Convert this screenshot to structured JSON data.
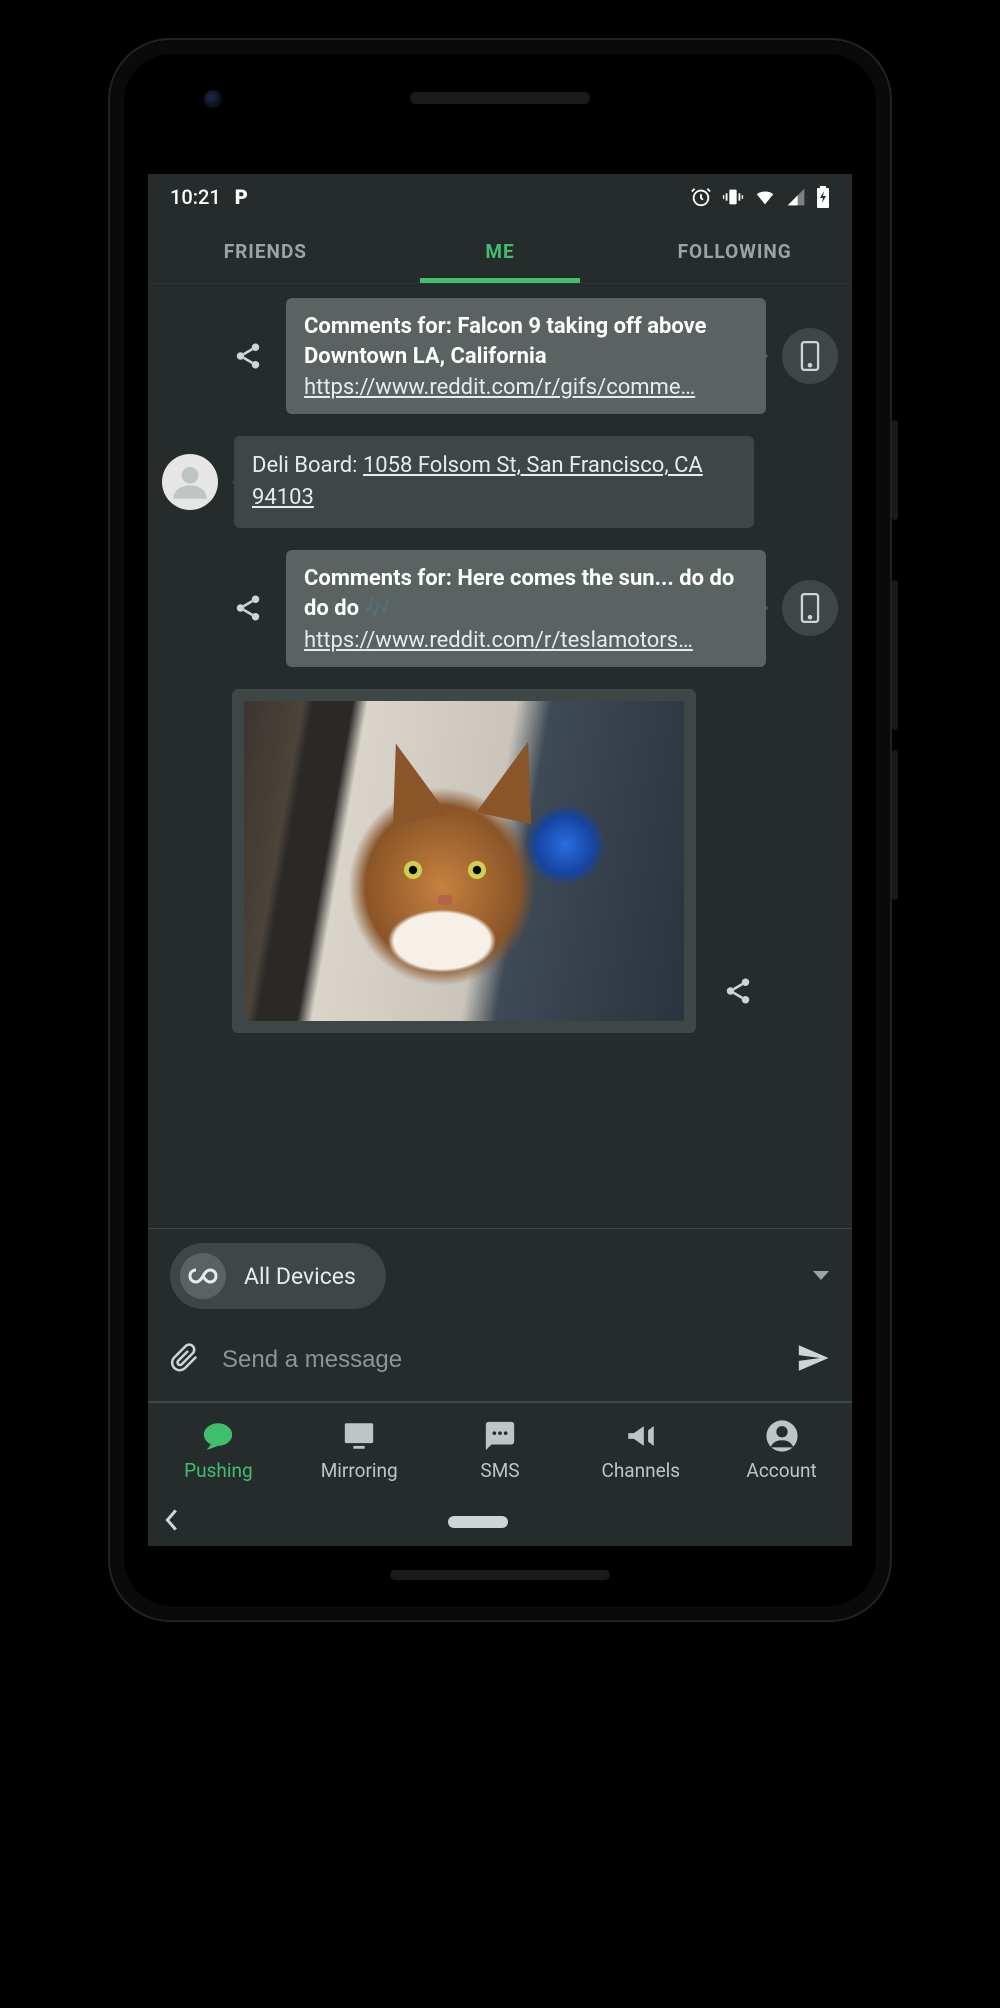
{
  "status": {
    "time": "10:21",
    "app_indicator": "P"
  },
  "tabs": {
    "friends": "FRIENDS",
    "me": "ME",
    "following": "FOLLOWING",
    "active": "me"
  },
  "messages": [
    {
      "type": "outgoing_link",
      "title": "Comments for: Falcon 9 taking off above Downtown LA, California",
      "url": "https://www.reddit.com/r/gifs/comme…",
      "target_icon": "phone"
    },
    {
      "type": "incoming_text",
      "prefix": "Deli Board: ",
      "linked_text": "1058 Folsom St, San Francisco, CA 94103"
    },
    {
      "type": "outgoing_link",
      "title": "Comments for: Here comes the sun... do do do do 🎶",
      "url": "https://www.reddit.com/r/teslamotors…",
      "target_icon": "phone"
    },
    {
      "type": "incoming_image",
      "alt": "Photo of a tabby cat looking at camera, TV in background"
    }
  ],
  "device_selector": {
    "label": "All Devices",
    "icon": "infinity"
  },
  "compose": {
    "placeholder": "Send a message"
  },
  "bottom_nav": {
    "items": [
      {
        "key": "pushing",
        "label": "Pushing",
        "icon": "chat",
        "active": true
      },
      {
        "key": "mirroring",
        "label": "Mirroring",
        "icon": "monitor",
        "active": false
      },
      {
        "key": "sms",
        "label": "SMS",
        "icon": "sms",
        "active": false
      },
      {
        "key": "channels",
        "label": "Channels",
        "icon": "megaphone",
        "active": false
      },
      {
        "key": "account",
        "label": "Account",
        "icon": "account",
        "active": false
      }
    ]
  }
}
